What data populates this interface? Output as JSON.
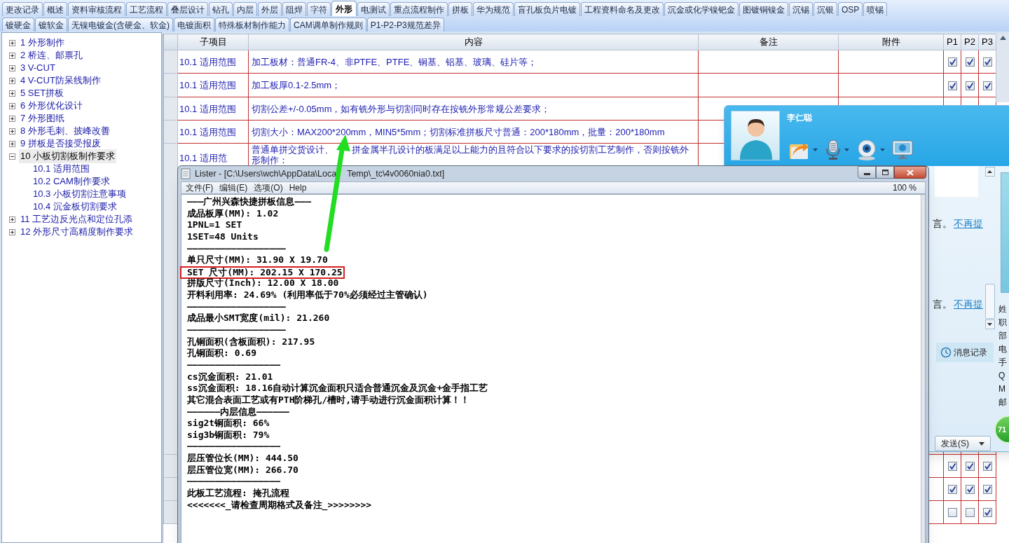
{
  "tabs_row_1": [
    {
      "label": "更改记录",
      "selected": false
    },
    {
      "label": "概述",
      "selected": false
    },
    {
      "label": "资料审核流程",
      "selected": false
    },
    {
      "label": "工艺流程",
      "selected": false
    },
    {
      "label": "叠层设计",
      "selected": false
    },
    {
      "label": "钻孔",
      "selected": false
    },
    {
      "label": "内层",
      "selected": false
    },
    {
      "label": "外层",
      "selected": false
    },
    {
      "label": "阻焊",
      "selected": false
    },
    {
      "label": "字符",
      "selected": false
    },
    {
      "label": "外形",
      "selected": true
    },
    {
      "label": "电测试",
      "selected": false
    },
    {
      "label": "重点流程制作",
      "selected": false
    },
    {
      "label": "拼板",
      "selected": false
    },
    {
      "label": "华为规范",
      "selected": false
    },
    {
      "label": "盲孔板负片电镀",
      "selected": false
    },
    {
      "label": "工程资料命名及更改",
      "selected": false
    },
    {
      "label": "沉金或化学镍钯金",
      "selected": false
    },
    {
      "label": "图镀铜镍金",
      "selected": false
    },
    {
      "label": "沉锡",
      "selected": false
    },
    {
      "label": "沉银",
      "selected": false
    },
    {
      "label": "OSP",
      "selected": false
    },
    {
      "label": "喷锡",
      "selected": false
    }
  ],
  "tabs_row_2": [
    {
      "label": "镀硬金",
      "selected": false
    },
    {
      "label": "镀软金",
      "selected": false
    },
    {
      "label": "无镍电镀金(含硬金、软金)",
      "selected": false
    },
    {
      "label": "电镀面积",
      "selected": false
    },
    {
      "label": "特殊板材制作能力",
      "selected": false
    },
    {
      "label": "CAM调单制作规则",
      "selected": false
    },
    {
      "label": "P1-P2-P3规范差异",
      "selected": false
    }
  ],
  "tree": [
    {
      "label": "1 外形制作",
      "expanded": false,
      "selected": false
    },
    {
      "label": "2 桥连、邮票孔",
      "expanded": false,
      "selected": false
    },
    {
      "label": "3 V-CUT",
      "expanded": false,
      "selected": false
    },
    {
      "label": "4 V-CUT防呆线制作",
      "expanded": false,
      "selected": false
    },
    {
      "label": "5 SET拼板",
      "expanded": false,
      "selected": false
    },
    {
      "label": "6 外形优化设计",
      "expanded": false,
      "selected": false
    },
    {
      "label": "7 外形图纸",
      "expanded": false,
      "selected": false
    },
    {
      "label": "8 外形毛刺、披峰改善",
      "expanded": false,
      "selected": false
    },
    {
      "label": "9 拼板是否接受报废",
      "expanded": false,
      "selected": false
    },
    {
      "label": "10 小板切割板制作要求",
      "expanded": true,
      "selected": true,
      "children": [
        {
          "label": "10.1 适用范围",
          "selected": false
        },
        {
          "label": "10.2 CAM制作要求",
          "selected": false
        },
        {
          "label": "10.3 小板切割注意事项",
          "selected": false
        },
        {
          "label": "10.4 沉金板切割要求",
          "selected": false
        }
      ]
    },
    {
      "label": "11 工艺边反光点和定位孔添",
      "expanded": false,
      "selected": false
    },
    {
      "label": "12 外形尺寸高精度制作要求",
      "expanded": false,
      "selected": false
    }
  ],
  "table": {
    "columns": [
      "子项目",
      "内容",
      "备注",
      "附件",
      "P1",
      "P2",
      "P3"
    ],
    "rows": [
      {
        "subitem": "10.1 适用范围",
        "content": "加工板材：普通FR-4、非PTFE、PTFE、铜基、铝基、玻璃、硅片等；",
        "checks": [
          true,
          true,
          true
        ]
      },
      {
        "subitem": "10.1 适用范围",
        "content": "加工板厚0.1-2.5mm；",
        "checks": [
          true,
          true,
          true
        ]
      },
      {
        "subitem": "10.1 适用范围",
        "content": "切割公差+/-0.05mm，如有铣外形与切割同时存在按铣外形常规公差要求；"
      },
      {
        "subitem": "10.1 适用范围",
        "content": "切割大小：MAX200*200mm，MIN5*5mm；切割标准拼板尺寸普通：200*180mm，批量：200*180mm"
      },
      {
        "subitem": "10.1 适用范",
        "content": "普通单拼交货设计、　　拼金属半孔设计的板满足以上能力的且符合以下要求的按切割工艺制作，否则按铣外形制作："
      },
      {
        "checks": [
          true,
          true,
          true
        ]
      },
      {
        "checks": [
          true,
          true,
          true
        ]
      },
      {
        "checks": [
          false,
          false,
          true
        ]
      }
    ]
  },
  "chat_window": {
    "contact_name": "李仁聪",
    "messages": [
      {
        "text": "言。",
        "link": "不再提"
      },
      {
        "text": "言。",
        "link": "不再提"
      }
    ],
    "history_button": "消息记录",
    "send_button": "发送(S)",
    "profile_labels": [
      "姓",
      "职",
      "部",
      "电",
      "手",
      "Q",
      "M",
      "邮"
    ],
    "badge": "71"
  },
  "lister": {
    "title_parts": [
      "Lister - [C:\\Users\\wch\\AppData\\Loca",
      "Temp\\_tc\\4v0060nia0.txt]"
    ],
    "menu": [
      "文件(F)",
      "编辑(E)",
      "选项(O)",
      "Help"
    ],
    "zoom": "100 %",
    "lines": [
      {
        "text": "———广州兴森快捷拼板信息———",
        "boxed": false
      },
      {
        "text": "成品板厚(MM): 1.02",
        "boxed": false
      },
      {
        "text": "1PNL=1 SET",
        "boxed": false
      },
      {
        "text": "1SET=48 Units",
        "boxed": false
      },
      {
        "text": "——————————————————",
        "boxed": false
      },
      {
        "text": "单只尺寸(MM): 31.90 X 19.70",
        "boxed": false
      },
      {
        "text": "SET 尺寸(MM): 202.15 X 170.25",
        "boxed": true
      },
      {
        "text": "拼版尺寸(Inch): 12.00 X 18.00",
        "boxed": false
      },
      {
        "text": "开料利用率: 24.69% (利用率低于70%必须经过主管确认)",
        "boxed": false
      },
      {
        "text": "——————————————————",
        "boxed": false
      },
      {
        "text": "成品最小SMT宽度(mil): 21.260",
        "boxed": false
      },
      {
        "text": "——————————————————",
        "boxed": false
      },
      {
        "text": "孔铜面积(含板面积): 217.95",
        "boxed": false
      },
      {
        "text": "孔铜面积: 0.69",
        "boxed": false
      },
      {
        "text": "—————————————————",
        "boxed": false
      },
      {
        "text": "cs沉金面积: 21.01",
        "boxed": false
      },
      {
        "text": "ss沉金面积: 18.16自动计算沉金面积只适合普通沉金及沉金+金手指工艺",
        "boxed": false
      },
      {
        "text": "其它混合表面工艺或有PTH阶梯孔/槽时,请手动进行沉金面积计算！！",
        "boxed": false
      },
      {
        "text": "——————内层信息——————",
        "boxed": false
      },
      {
        "text": "sig2t铜面积: 66%",
        "boxed": false
      },
      {
        "text": "sig3b铜面积: 79%",
        "boxed": false
      },
      {
        "text": "—————————————————",
        "boxed": false
      },
      {
        "text": "层压管位长(MM): 444.50",
        "boxed": false
      },
      {
        "text": "层压管位宽(MM): 266.70",
        "boxed": false
      },
      {
        "text": "—————————————————",
        "boxed": false
      },
      {
        "text": "此板工艺流程: 掩孔流程",
        "boxed": false
      },
      {
        "text": "<<<<<<<_请检查周期格式及备注_>>>>>>>>",
        "boxed": false
      }
    ]
  }
}
